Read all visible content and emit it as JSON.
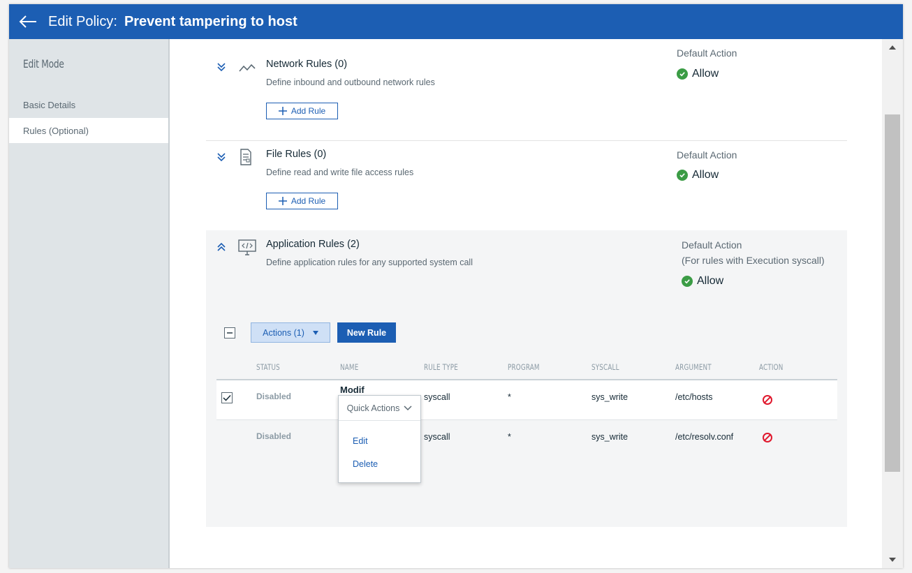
{
  "header": {
    "title_prefix": "Edit Policy:",
    "policy_name": "Prevent tampering to host"
  },
  "sidebar": {
    "heading": "Edit Mode",
    "items": [
      {
        "label": "Basic Details"
      },
      {
        "label": "Rules (Optional)"
      }
    ]
  },
  "sections": {
    "network": {
      "title": "Network Rules (0)",
      "description": "Define inbound and outbound network rules",
      "add_label": "Add Rule",
      "default_label": "Default Action",
      "default_value": "Allow"
    },
    "file": {
      "title": "File Rules (0)",
      "description": "Define read and write file access rules",
      "add_label": "Add Rule",
      "default_label": "Default Action",
      "default_value": "Allow"
    },
    "application": {
      "title": "Application Rules (2)",
      "description": "Define application rules for any supported system call",
      "default_label": "Default Action",
      "default_sublabel": "(For rules with Execution syscall)",
      "default_value": "Allow"
    }
  },
  "toolbar": {
    "actions_label": "Actions (1)",
    "new_rule_label": "New Rule"
  },
  "table": {
    "columns": [
      "STATUS",
      "NAME",
      "RULE TYPE",
      "PROGRAM",
      "SYSCALL",
      "ARGUMENT",
      "ACTION"
    ],
    "rows": [
      {
        "status": "Disabled",
        "name": "Modif",
        "rule_type": "syscall",
        "program": "*",
        "syscall": "sys_write",
        "argument": "/etc/hosts",
        "action": "block-icon",
        "checked": true
      },
      {
        "status": "Disabled",
        "name": "",
        "rule_type": "syscall",
        "program": "*",
        "syscall": "sys_write",
        "argument": "/etc/resolv.conf",
        "action": "block-icon",
        "checked": false
      }
    ]
  },
  "quick_actions": {
    "label": "Quick Actions",
    "items": [
      "Edit",
      "Delete"
    ]
  },
  "colors": {
    "brand": "#1c5eb3",
    "success": "#3b9c45",
    "danger": "#e0182d",
    "sidebar_bg": "#dfe4e7"
  }
}
